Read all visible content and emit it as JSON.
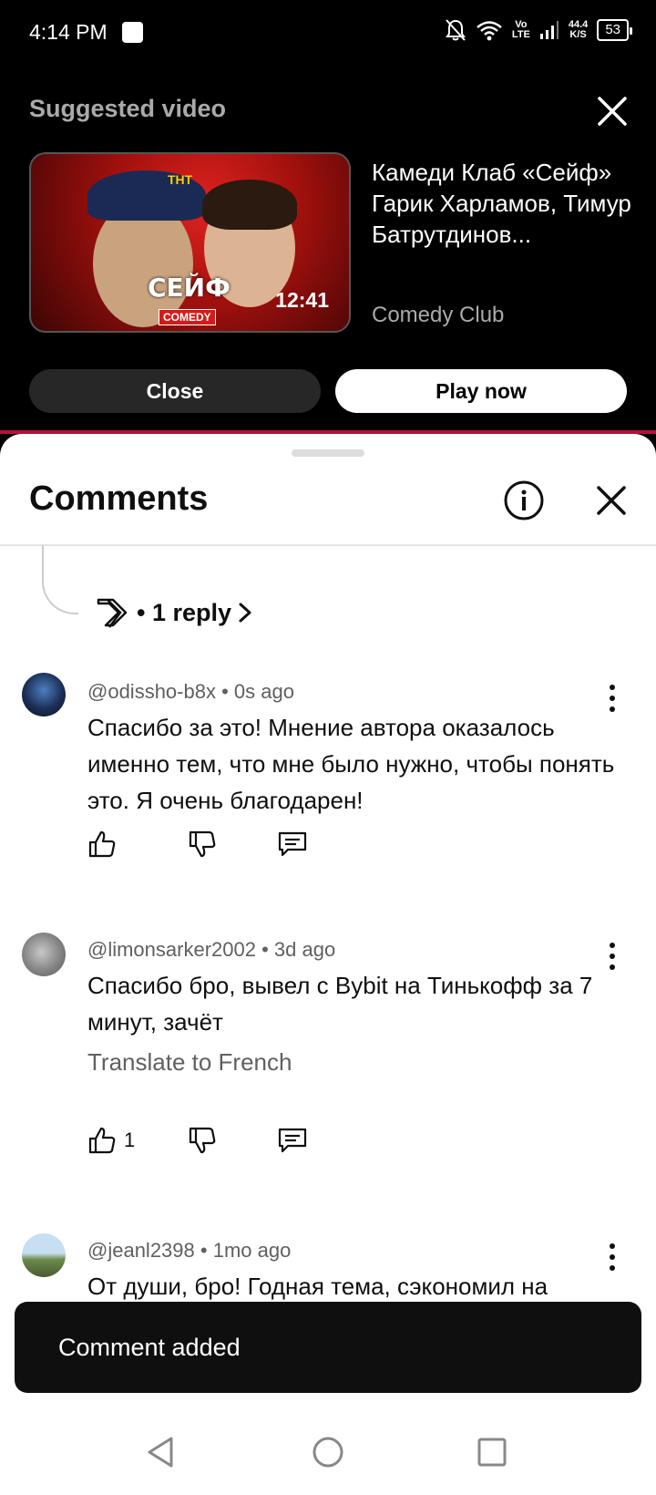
{
  "status_bar": {
    "time": "4:14 PM",
    "volte_top": "Vo",
    "volte_bottom": "LTE",
    "speed_top": "44.4",
    "speed_bottom": "K/S",
    "battery": "53",
    "icons": [
      "notifications-off-icon",
      "wifi-icon",
      "signal-icon",
      "battery-icon"
    ]
  },
  "suggested": {
    "heading": "Suggested video",
    "video_title": "Камеди Клаб «Сейф» Гарик Харламов, Тимур Батрутдинов...",
    "channel": "Comedy Club",
    "duration": "12:41",
    "thumb_logo": "СЕЙФ",
    "thumb_badge": "COMEDY",
    "thumb_channel": "ТНТ",
    "close_label": "Close",
    "play_label": "Play now"
  },
  "comments_sheet": {
    "title": "Comments",
    "reply_count": "• 1 reply",
    "comments": [
      {
        "author": "@odissho-b8x",
        "age": "• 0s ago",
        "text": "Спасибо за это! Мнение автора оказалось именно тем, что мне было нужно, чтобы понять это. Я очень благодарен!",
        "likes": ""
      },
      {
        "author": "@limonsarker2002",
        "age": "• 3d ago",
        "text": "Спасибо бро, вывел с Bybit на Тинькофф за 7 минут, зачёт",
        "translate": "Translate to French",
        "likes": "1"
      },
      {
        "author": "@jeanl2398",
        "age": "• 1mo ago",
        "text": "От души, бро! Годная тема, сэкономил на",
        "likes": ""
      }
    ]
  },
  "toast": {
    "text": "Comment added"
  },
  "colors": {
    "accent_line": "#b3123c",
    "toast_bg": "#0f0f0f",
    "secondary_text": "#606060"
  }
}
